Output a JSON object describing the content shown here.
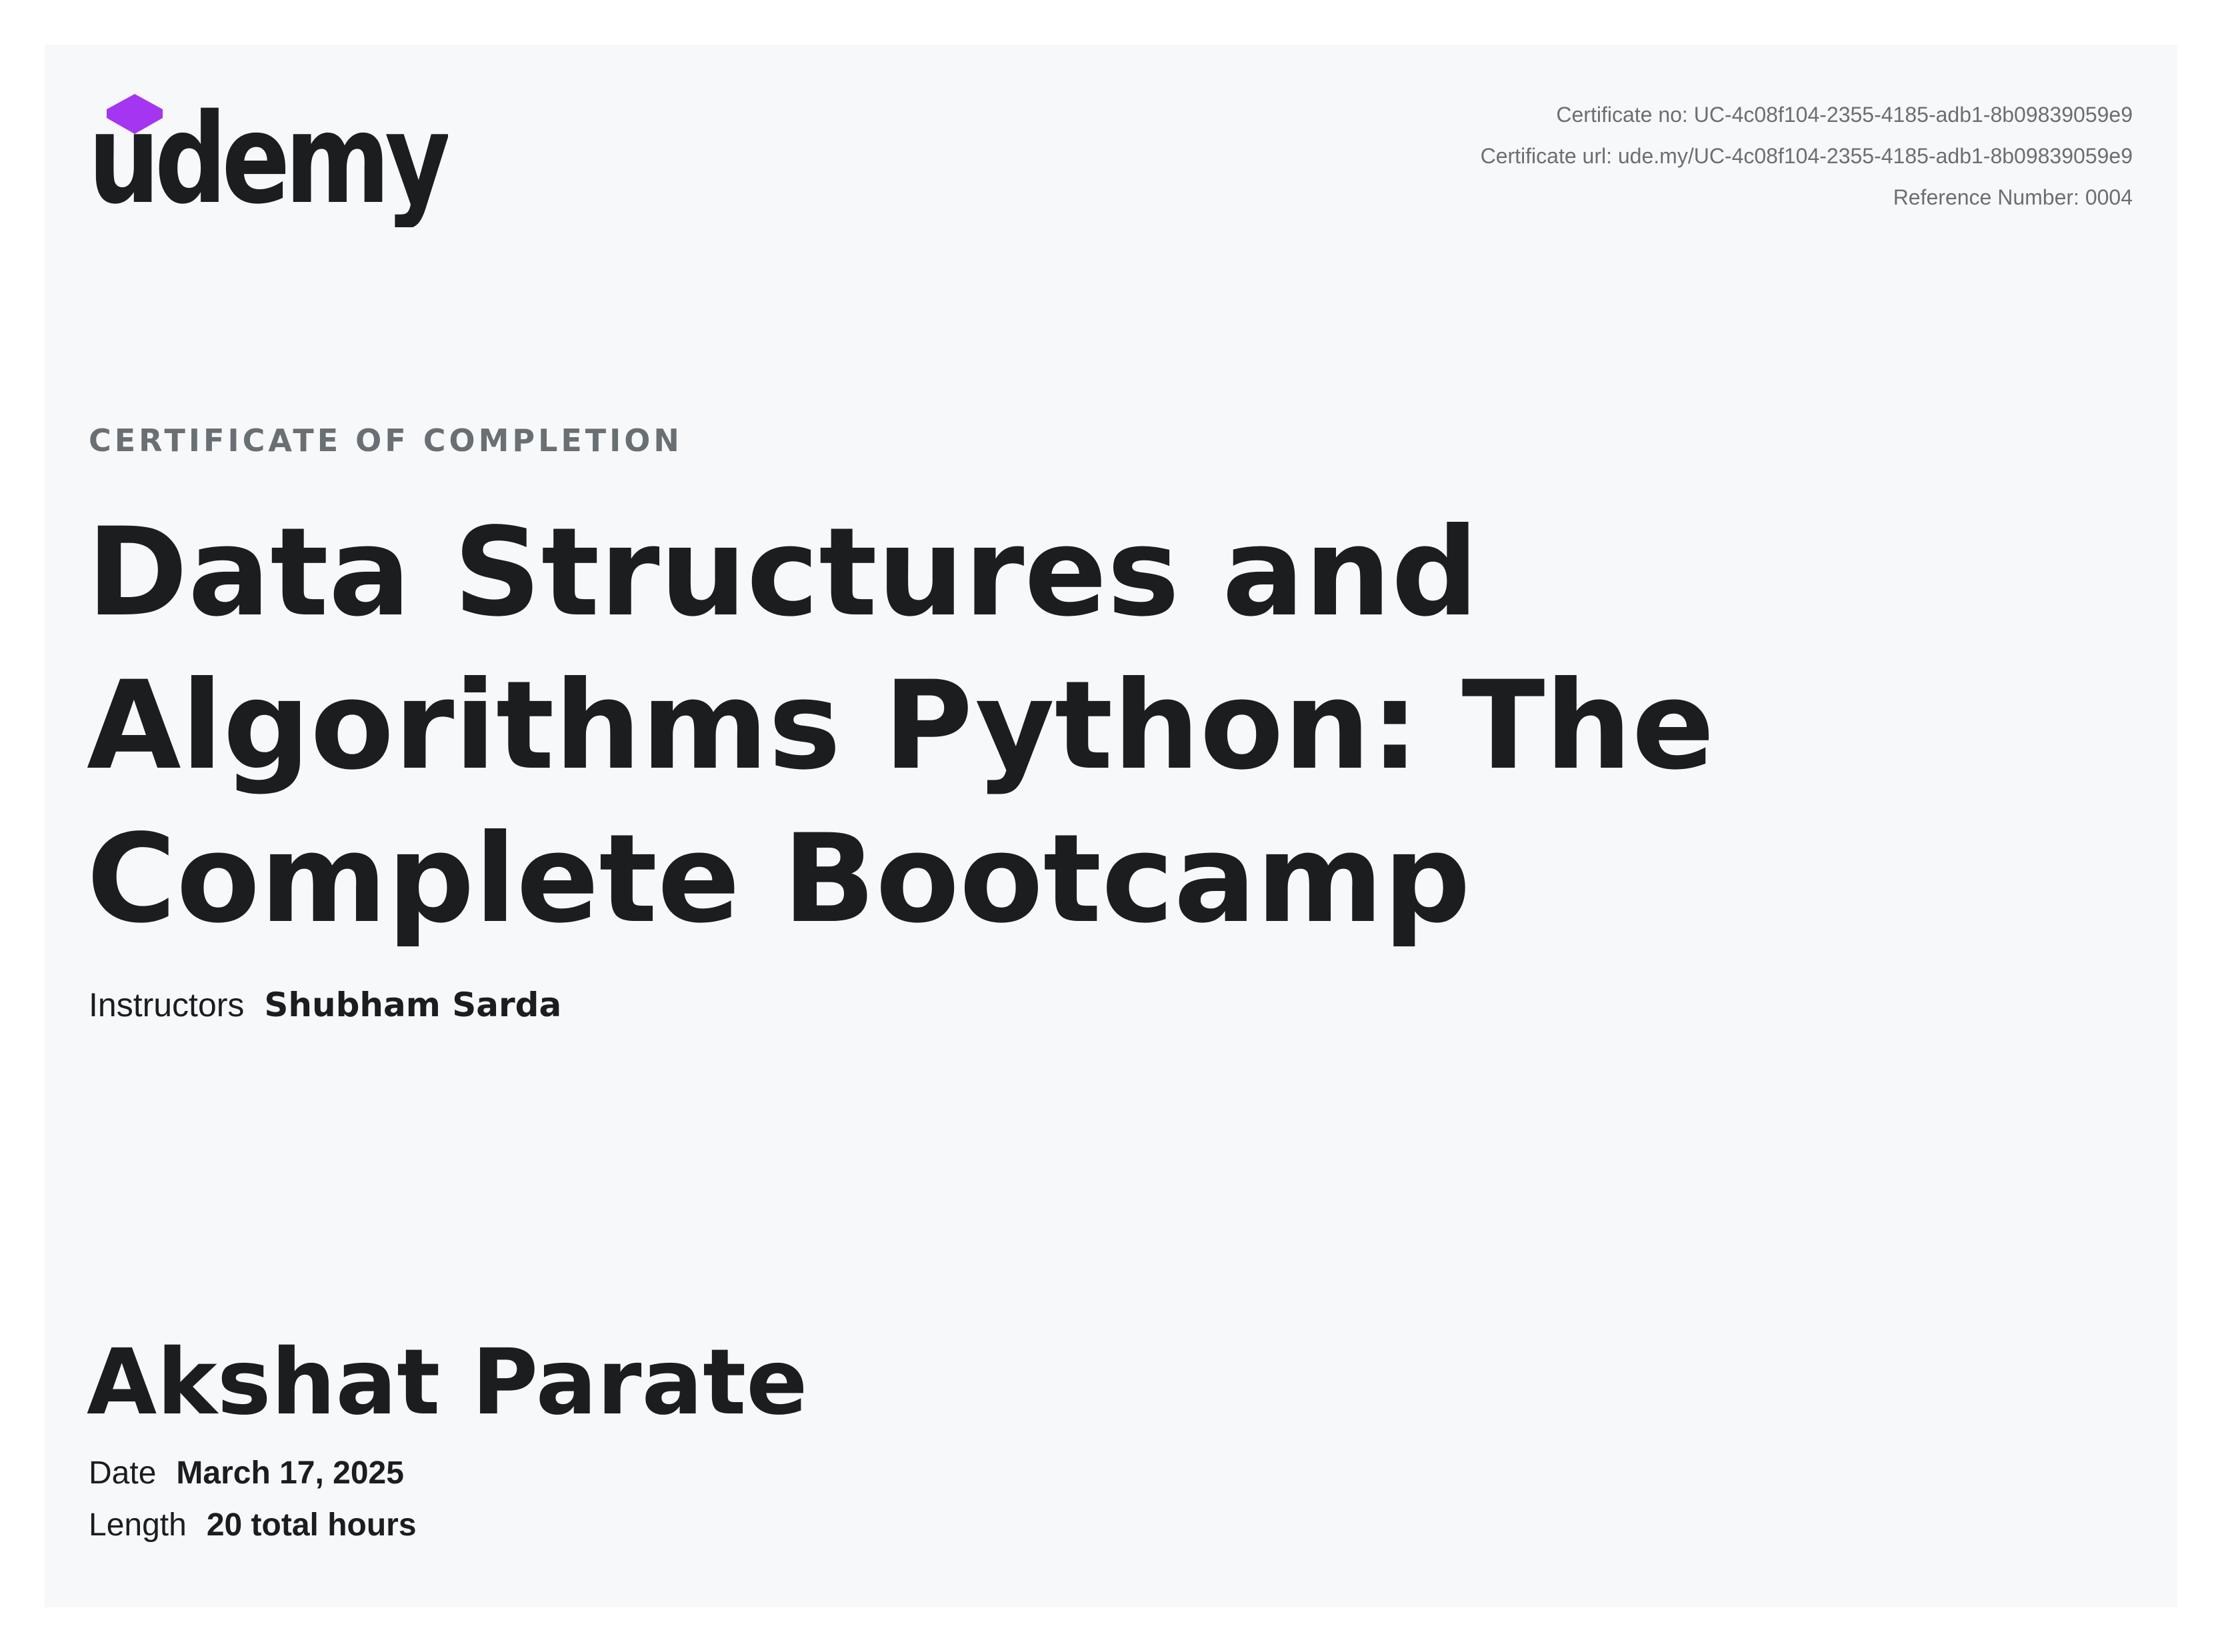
{
  "brand": {
    "wordmark": "udemy",
    "accent_color": "#a435f0",
    "text_color": "#1c1d1f"
  },
  "certificate_meta": {
    "certificate_no": "Certificate no: UC-4c08f104-2355-4185-adb1-8b09839059e9",
    "certificate_url": "Certificate url: ude.my/UC-4c08f104-2355-4185-adb1-8b09839059e9",
    "reference_number": "Reference Number: 0004"
  },
  "heading": "CERTIFICATE OF COMPLETION",
  "course": {
    "title_lines": [
      "Data Structures and",
      "Algorithms Python: The",
      "Complete Bootcamp"
    ]
  },
  "instructors": {
    "label": "Instructors",
    "name": "Shubham Sarda"
  },
  "student_name": "Akshat Parate",
  "details": {
    "date_label": "Date",
    "date_value": "March 17, 2025",
    "length_label": "Length",
    "length_value": "20 total hours"
  }
}
